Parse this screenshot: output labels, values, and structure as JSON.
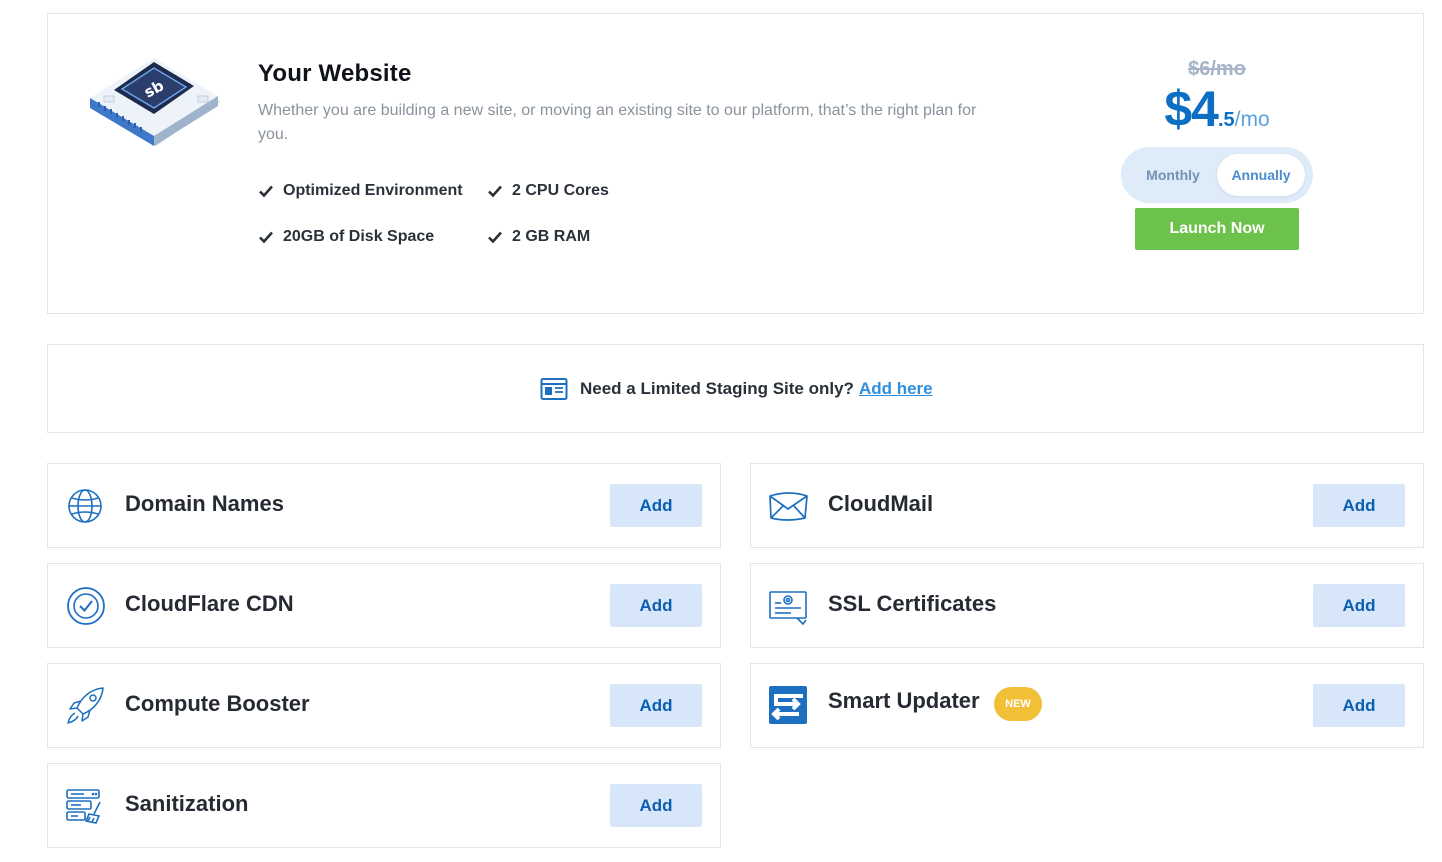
{
  "plan": {
    "title": "Your Website",
    "description": "Whether you are building a new site, or moving an existing site to our platform, that’s the right plan for you.",
    "logo_icon": "sb-server-chip-icon",
    "features": [
      "Optimized Environment",
      "2 CPU Cores",
      "20GB of Disk Space",
      "2 GB RAM"
    ],
    "old_price": "$6/mo",
    "price_int": "$4",
    "price_dec": ".5",
    "price_per": "/mo",
    "billing_options": [
      "Monthly",
      "Annually"
    ],
    "billing_selected": "Annually",
    "launch_label": "Launch Now"
  },
  "staging": {
    "text": "Need a Limited Staging Site only?",
    "link_label": "Add here",
    "icon": "browser-window-icon"
  },
  "addons": {
    "domain_names": {
      "name": "Domain Names",
      "icon": "globe-icon",
      "button": "Add"
    },
    "cloudmail": {
      "name": "CloudMail",
      "icon": "envelope-icon",
      "button": "Add"
    },
    "cloudflare_cdn": {
      "name": "CloudFlare CDN",
      "icon": "check-circle-icon",
      "button": "Add"
    },
    "ssl_certificates": {
      "name": "SSL Certificates",
      "icon": "certificate-icon",
      "button": "Add"
    },
    "compute_booster": {
      "name": "Compute Booster",
      "icon": "rocket-icon",
      "button": "Add"
    },
    "smart_updater": {
      "name": "Smart Updater",
      "badge": "NEW",
      "icon": "swap-arrows-icon",
      "button": "Add"
    },
    "sanitization": {
      "name": "Sanitization",
      "icon": "server-broom-icon",
      "button": "Add"
    }
  },
  "colors": {
    "accent_blue": "#0b6fc4",
    "launch_green": "#6cc24a",
    "add_button_bg": "#d8e6fa",
    "badge_yellow": "#f2c037"
  }
}
